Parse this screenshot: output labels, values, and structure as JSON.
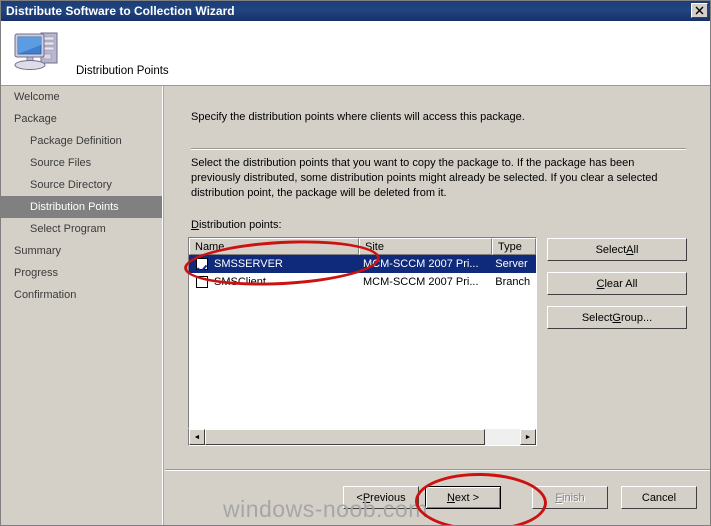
{
  "window": {
    "title": "Distribute Software to Collection Wizard",
    "close_label": "×"
  },
  "header": {
    "icon": "computer-server-icon",
    "title": "Distribution Points"
  },
  "sidebar": {
    "items": [
      {
        "label": "Welcome",
        "indent": false,
        "active": false
      },
      {
        "label": "Package",
        "indent": false,
        "active": false
      },
      {
        "label": "Package Definition",
        "indent": true,
        "active": false
      },
      {
        "label": "Source Files",
        "indent": true,
        "active": false
      },
      {
        "label": "Source Directory",
        "indent": true,
        "active": false
      },
      {
        "label": "Distribution Points",
        "indent": true,
        "active": true
      },
      {
        "label": "Select Program",
        "indent": true,
        "active": false
      },
      {
        "label": "Summary",
        "indent": false,
        "active": false
      },
      {
        "label": "Progress",
        "indent": false,
        "active": false
      },
      {
        "label": "Confirmation",
        "indent": false,
        "active": false
      }
    ]
  },
  "content": {
    "intro": "Specify the distribution points where clients will access this package.",
    "description": "Select the distribution points that you want to copy the package to. If the package has been previously distributed, some distribution points might already be selected. If you clear a selected distribution point, the package will be deleted from it.",
    "list_label_prefix": "D",
    "list_label_rest": "istribution points:",
    "columns": [
      "Name",
      "Site",
      "Type"
    ],
    "rows": [
      {
        "checked": true,
        "name": "SMSSERVER",
        "site": "MCM-SCCM 2007 Pri...",
        "type": "Server",
        "selected": true
      },
      {
        "checked": false,
        "name": "SMSClient",
        "site": "MCM-SCCM 2007 Pri...",
        "type": "Branch",
        "selected": false
      }
    ],
    "scrollbar": {
      "left_arrow": "◄",
      "right_arrow": "►"
    }
  },
  "side_buttons": [
    {
      "pre": "Select ",
      "accel": "A",
      "post": "ll"
    },
    {
      "pre": "",
      "accel": "C",
      "post": "lear All"
    },
    {
      "pre": "Select ",
      "accel": "G",
      "post": "roup..."
    }
  ],
  "footer_buttons": {
    "previous": {
      "pre": "< ",
      "accel": "P",
      "post": "revious",
      "disabled": false
    },
    "next": {
      "pre": "",
      "accel": "N",
      "post": "ext >",
      "disabled": false
    },
    "finish": {
      "pre": "",
      "accel": "F",
      "post": "inish",
      "disabled": true
    },
    "cancel": {
      "pre": "",
      "accel": "",
      "post": "Cancel",
      "disabled": false
    }
  },
  "watermark": "windows-noob.com",
  "colors": {
    "titlebar": "#1c3c76",
    "face": "#d4d0c8",
    "selection": "#0f2a7a",
    "annotation": "#cc1111",
    "nav_active": "#808080"
  }
}
